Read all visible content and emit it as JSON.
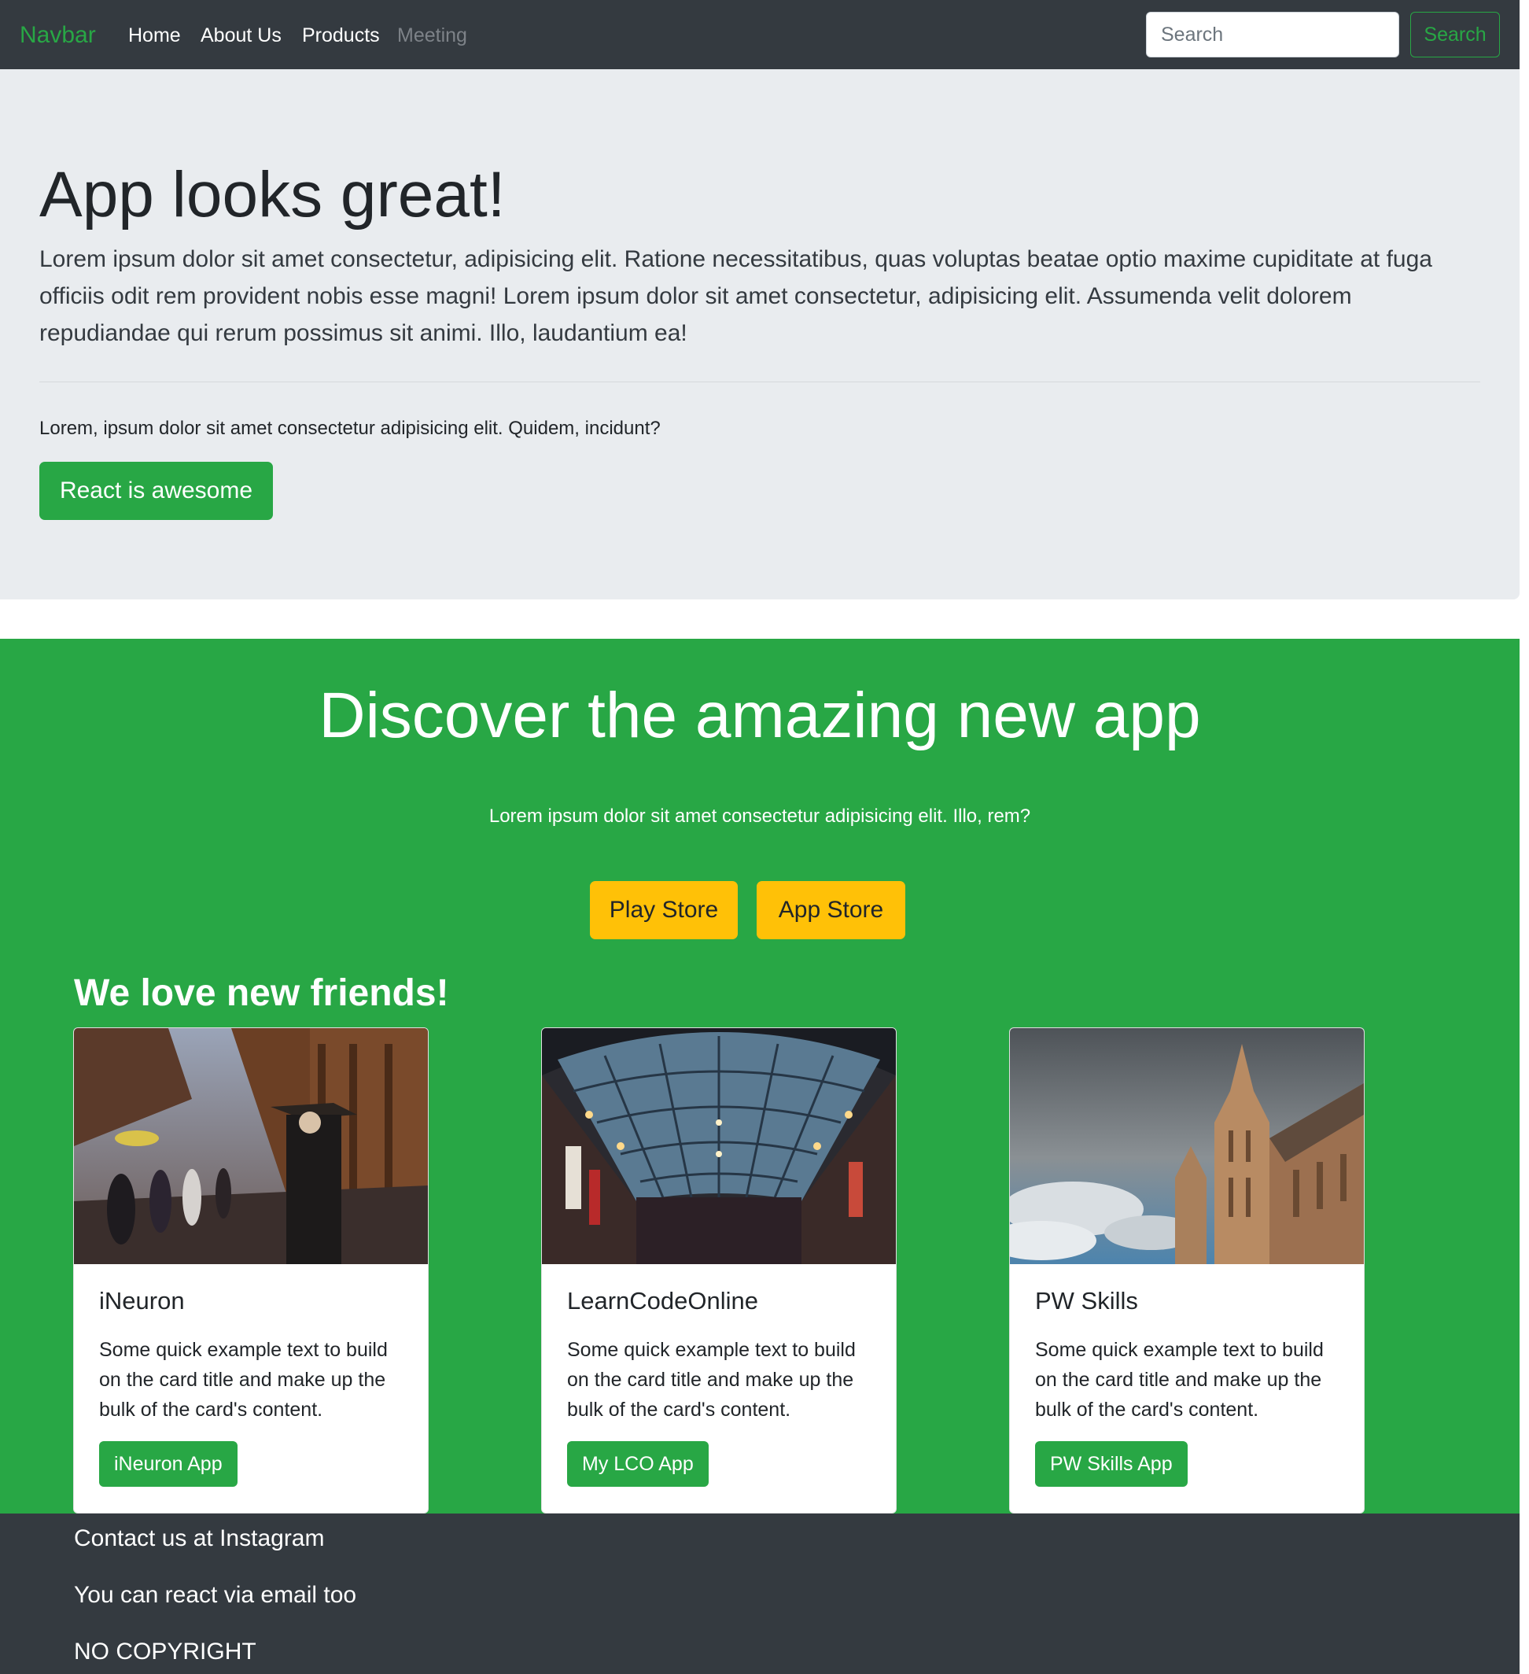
{
  "navbar": {
    "brand": "Navbar",
    "links": [
      "Home",
      "About Us",
      "Products",
      "Meeting"
    ],
    "search_placeholder": "Search",
    "search_button": "Search"
  },
  "jumbotron": {
    "title": "App looks great!",
    "lead": "Lorem ipsum dolor sit amet consectetur, adipisicing elit. Ratione necessitatibus, quas voluptas beatae optio maxime cupiditate at fuga officiis odit rem provident nobis esse magni! Lorem ipsum dolor sit amet consectetur, adipisicing elit. Assumenda velit dolorem repudiandae qui rerum possimus sit animi. Illo, laudantium ea!",
    "text": "Lorem, ipsum dolor sit amet consectetur adipisicing elit. Quidem, incidunt?",
    "button": "React is awesome"
  },
  "hero": {
    "title": "Discover the amazing new app",
    "text": "Lorem ipsum dolor sit amet consectetur adipisicing elit. Illo, rem?",
    "buttons": [
      "Play Store",
      "App Store"
    ],
    "friends_heading": "We love new friends!"
  },
  "cards": [
    {
      "title": "iNeuron",
      "text": "Some quick example text to build on the card title and make up the bulk of the card's content.",
      "button": "iNeuron App",
      "image": "street-photo"
    },
    {
      "title": "LearnCodeOnline",
      "text": "Some quick example text to build on the card title and make up the bulk of the card's content.",
      "button": "My LCO App",
      "image": "arcade-photo"
    },
    {
      "title": "PW Skills",
      "text": "Some quick example text to build on the card title and make up the bulk of the card's content.",
      "button": "PW Skills App",
      "image": "cathedral-photo"
    }
  ],
  "footer": {
    "lines": [
      "Contact us at Instagram",
      "You can react via email too",
      "NO COPYRIGHT"
    ]
  },
  "colors": {
    "dark": "#343a40",
    "green": "#28a745",
    "yellow": "#ffc107",
    "light": "#e9ecef"
  }
}
